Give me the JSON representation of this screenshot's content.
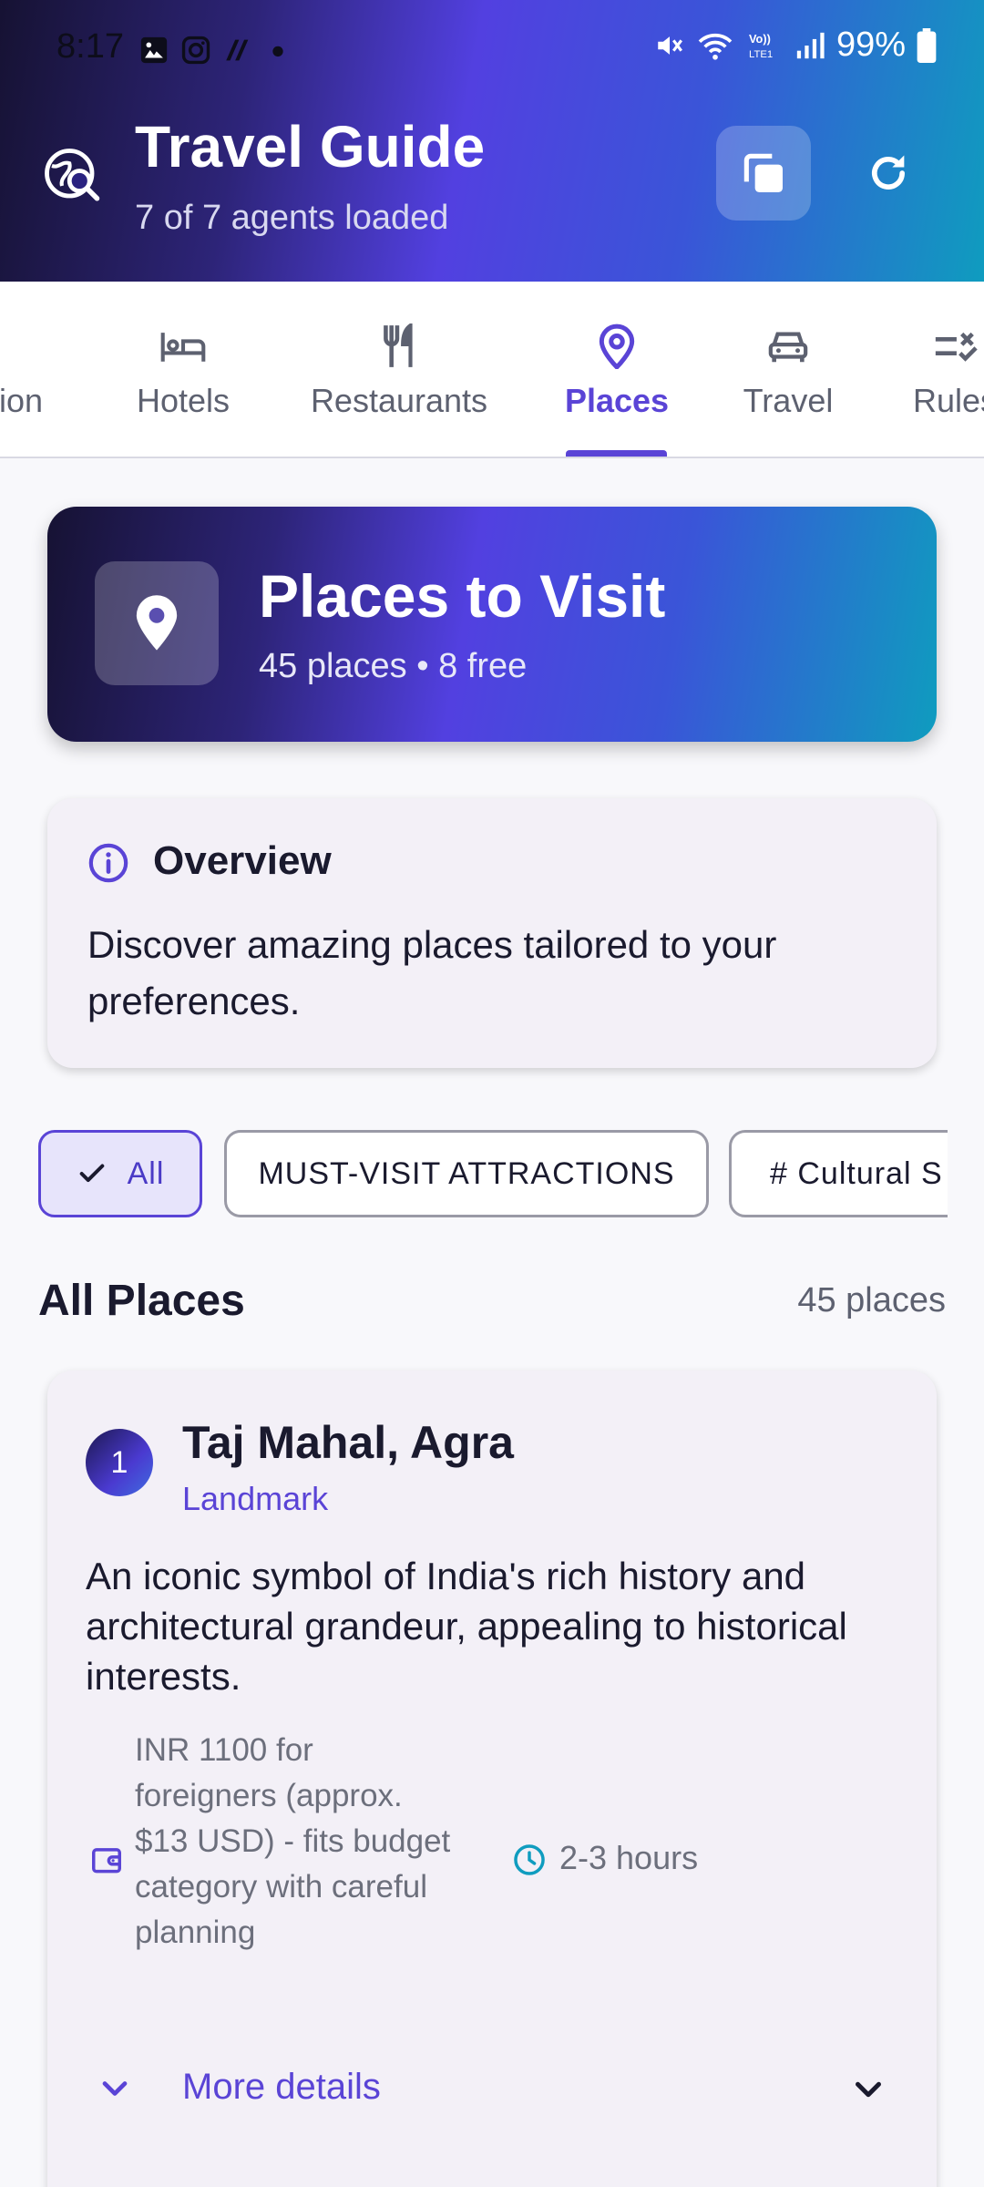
{
  "status_bar": {
    "time": "8:17",
    "battery": "99%",
    "left_icons": [
      "gallery-icon",
      "instagram-icon",
      "app-icon",
      "dot-icon"
    ],
    "right_icons": [
      "mute-icon",
      "wifi-icon",
      "volte-icon",
      "signal-icon",
      "battery-icon"
    ]
  },
  "header": {
    "title": "Travel Guide",
    "subtitle": "7 of 7 agents loaded"
  },
  "tabs": [
    {
      "label": "tion",
      "icon": "partial-tab"
    },
    {
      "label": "Hotels",
      "icon": "bed-icon"
    },
    {
      "label": "Restaurants",
      "icon": "utensils-icon"
    },
    {
      "label": "Places",
      "icon": "map-pin-icon",
      "active": true
    },
    {
      "label": "Travel",
      "icon": "car-icon"
    },
    {
      "label": "Rules",
      "icon": "rules-icon"
    }
  ],
  "hero": {
    "title": "Places to Visit",
    "subtitle": "45 places • 8 free"
  },
  "overview": {
    "title": "Overview",
    "text": "Discover amazing places tailored to your preferences."
  },
  "filters": [
    {
      "label": "All",
      "selected": true
    },
    {
      "label": "MUST-VISIT ATTRACTIONS",
      "selected": false
    },
    {
      "label": "# Cultural S",
      "selected": false
    }
  ],
  "section": {
    "title": "All Places",
    "count": "45 places"
  },
  "places": [
    {
      "number": "1",
      "name": "Taj Mahal, Agra",
      "category": "Landmark",
      "description": "An iconic symbol of India's rich history and architectural grandeur, appealing to historical interests.",
      "cost": "INR 1100 for foreigners (approx. $13 USD) - fits budget category with careful planning",
      "duration": "2-3 hours",
      "more_label": "More details"
    }
  ],
  "colors": {
    "accent": "#5a44d6",
    "gradient_start": "#161233",
    "gradient_mid": "#5240e0",
    "gradient_end": "#0f9cbf",
    "card_bg": "#f3f0f7",
    "duration_icon": "#0f9cbf"
  }
}
